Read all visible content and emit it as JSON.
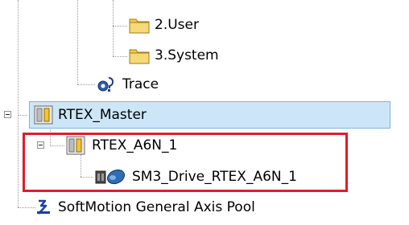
{
  "tree": {
    "items": [
      {
        "label": "2.User",
        "icon": "folder-icon"
      },
      {
        "label": "3.System",
        "icon": "folder-icon"
      },
      {
        "label": "Trace",
        "icon": "trace-icon"
      },
      {
        "label": "RTEX_Master",
        "icon": "master-device-icon",
        "selected": true
      },
      {
        "label": "RTEX_A6N_1",
        "icon": "slave-device-icon"
      },
      {
        "label": "SM3_Drive_RTEX_A6N_1",
        "icon": "drive-axis-icon"
      },
      {
        "label": "SoftMotion General Axis Pool",
        "icon": "axis-pool-icon"
      }
    ]
  },
  "colors": {
    "selection_fill": "#cde6f7",
    "selection_border": "#7fb3dc",
    "highlight_box": "#e01c2c",
    "folder": "#f2c94c"
  }
}
